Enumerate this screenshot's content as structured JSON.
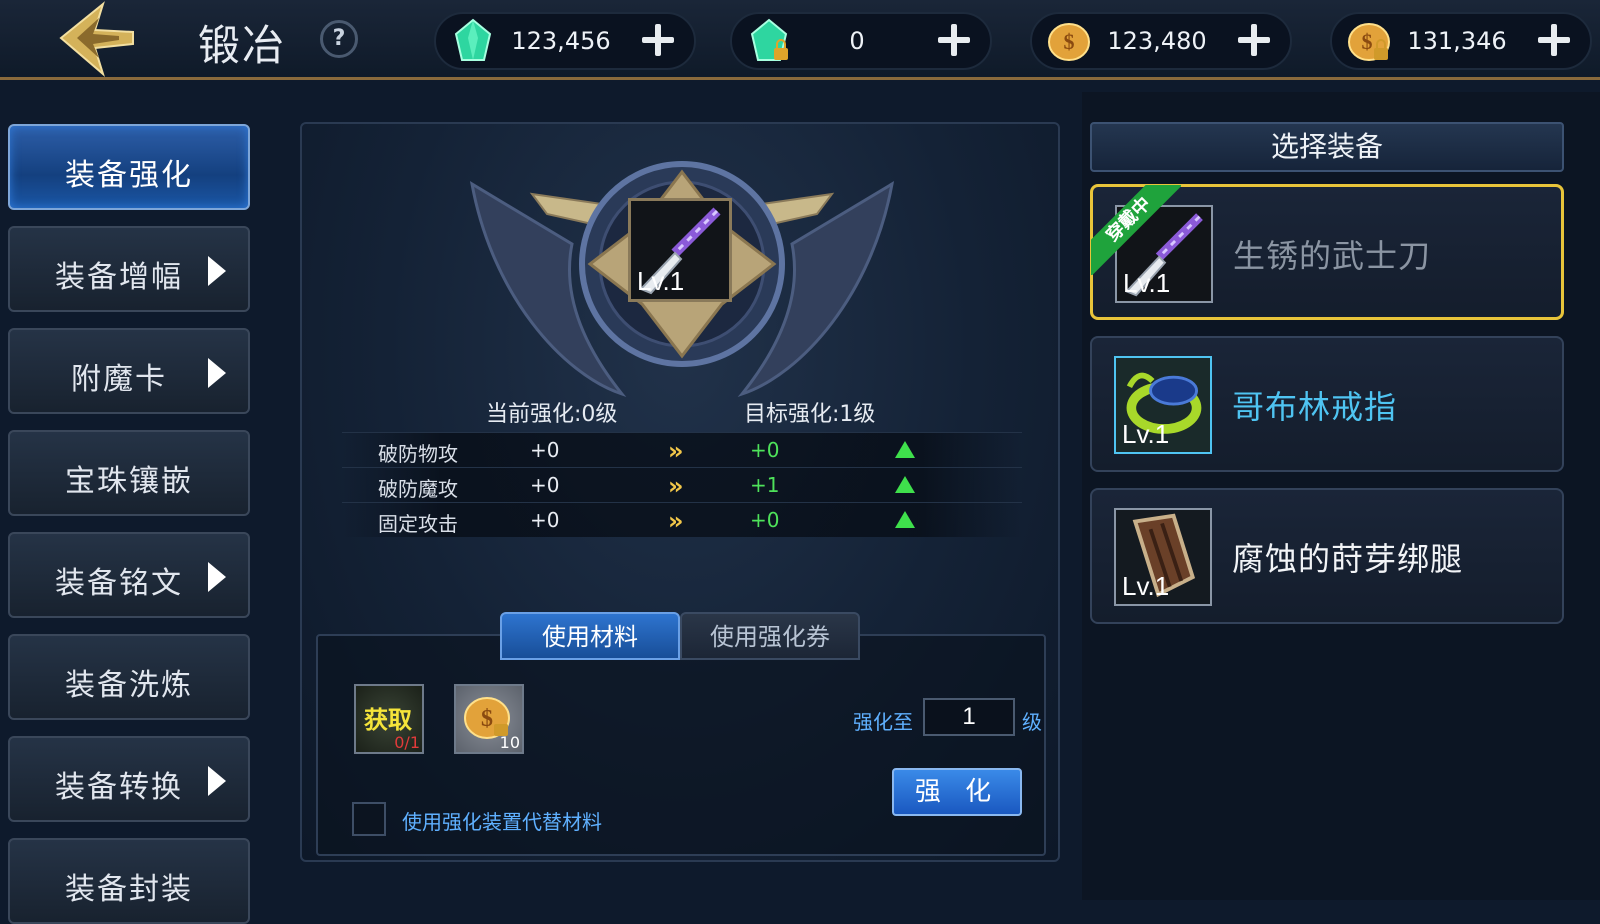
{
  "header": {
    "title": "锻冶",
    "help_symbol": "?",
    "currencies": [
      {
        "icon": "green-crystal-icon",
        "value": "123,456"
      },
      {
        "icon": "locked-green-crystal-icon",
        "value": "0"
      },
      {
        "icon": "gold-coin-icon",
        "value": "123,480"
      },
      {
        "icon": "locked-gold-coin-icon",
        "value": "131,346"
      }
    ]
  },
  "sidebar": {
    "items": [
      {
        "label": "装备强化",
        "active": true,
        "arrow": false
      },
      {
        "label": "装备增幅",
        "active": false,
        "arrow": true
      },
      {
        "label": "附魔卡",
        "active": false,
        "arrow": true
      },
      {
        "label": "宝珠镶嵌",
        "active": false,
        "arrow": false
      },
      {
        "label": "装备铭文",
        "active": false,
        "arrow": true
      },
      {
        "label": "装备洗炼",
        "active": false,
        "arrow": false
      },
      {
        "label": "装备转换",
        "active": false,
        "arrow": true
      },
      {
        "label": "装备封装",
        "active": false,
        "arrow": false
      }
    ]
  },
  "center": {
    "item_level": "Lv.1",
    "current_level": "当前强化:0级",
    "target_level": "目标强化:1级",
    "stats": [
      {
        "name": "破防物攻",
        "current": "+0",
        "arrow": "»",
        "next": "+0"
      },
      {
        "name": "破防魔攻",
        "current": "+0",
        "arrow": "»",
        "next": "+1"
      },
      {
        "name": "固定攻击",
        "current": "+0",
        "arrow": "»",
        "next": "+0"
      }
    ],
    "tabs": {
      "materials": "使用材料",
      "ticket": "使用强化券"
    },
    "materials": {
      "get_label": "获取",
      "get_count": "0/1",
      "coin_count": "10"
    },
    "enhance_to_label": "强化至",
    "enhance_to_value": "1",
    "enhance_unit": "级",
    "enhance_button": "强 化",
    "use_device_label": "使用强化装置代替材料"
  },
  "right": {
    "header": "选择装备",
    "equipped_badge": "穿戴中",
    "items": [
      {
        "name": "生锈的武士刀",
        "level": "Lv.1",
        "name_color": "#8b95a3",
        "icon": "katana-icon"
      },
      {
        "name": "哥布林戒指",
        "level": "Lv.1",
        "name_color": "#4fc4f2",
        "icon": "goblin-ring-icon"
      },
      {
        "name": "腐蚀的莳芽绑腿",
        "level": "Lv.1",
        "name_color": "#f2f4f7",
        "icon": "leggings-icon"
      }
    ]
  },
  "colors": {
    "accent": "#2e74cf",
    "selected_border": "#e8c43a",
    "stat_up": "#3fe04c",
    "link_blue": "#5fb0ff"
  }
}
